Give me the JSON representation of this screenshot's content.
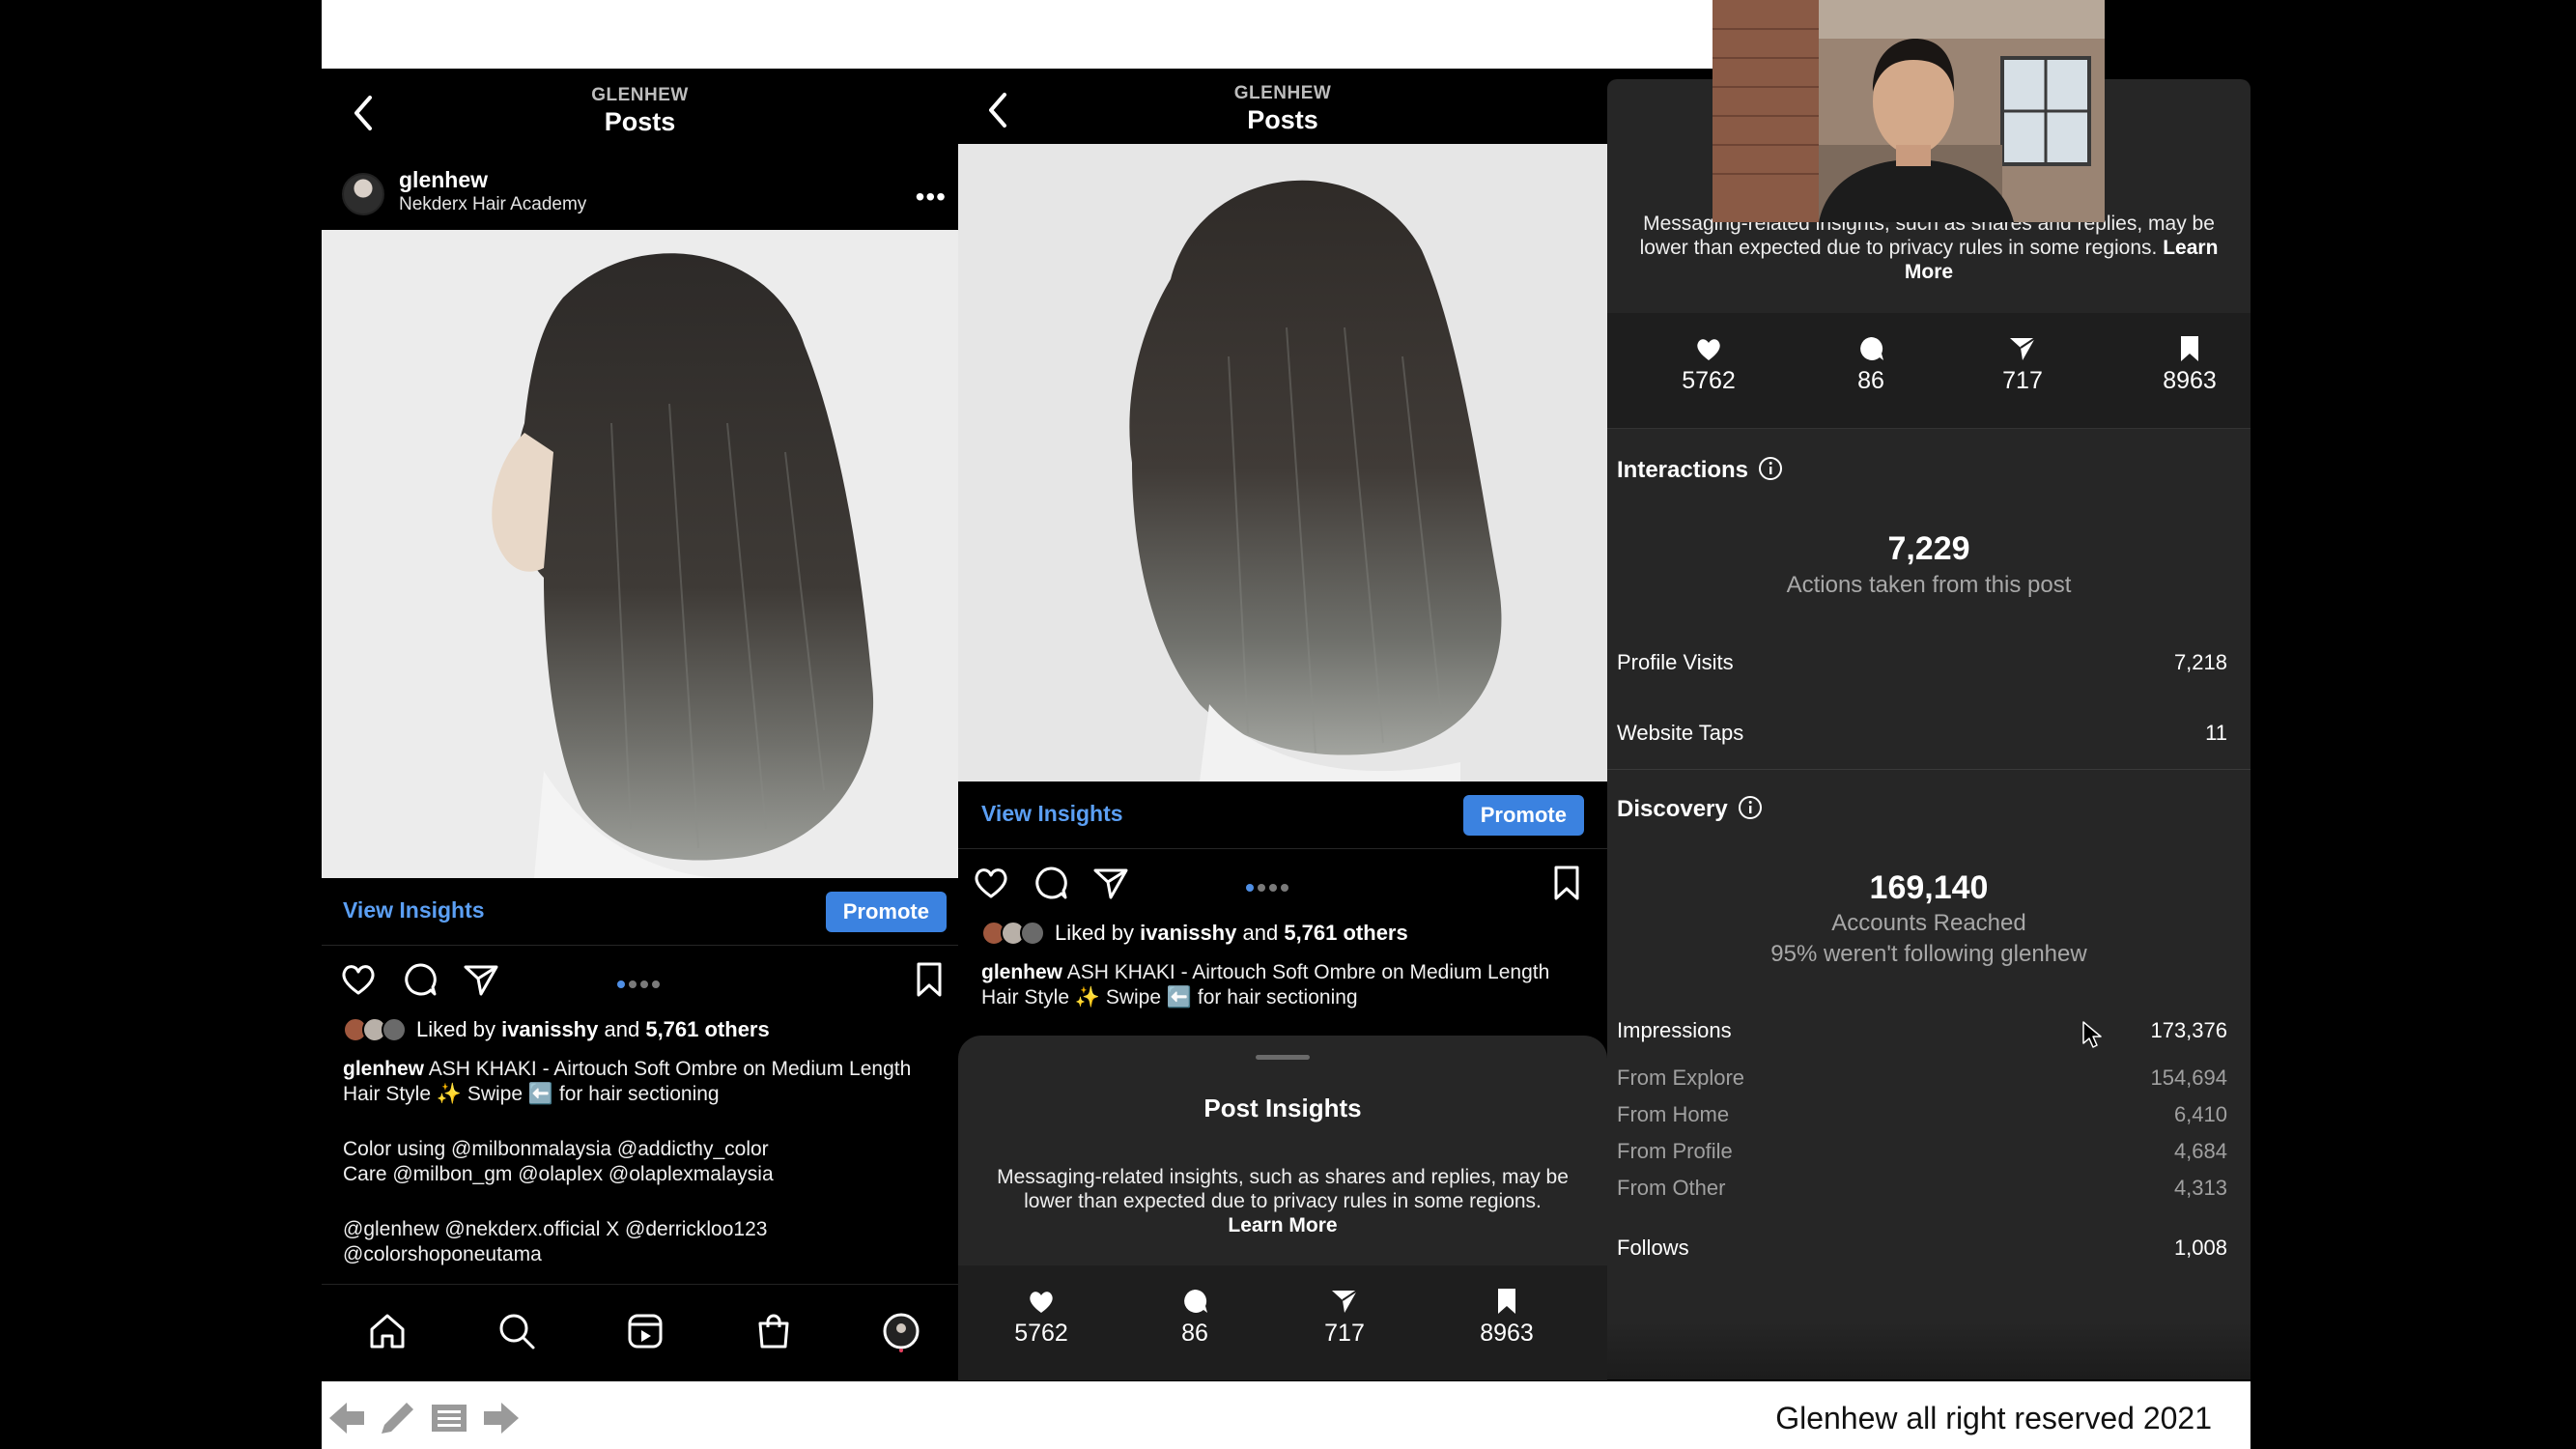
{
  "phone1": {
    "header_user": "GLENHEW",
    "header_title": "Posts",
    "username": "glenhew",
    "subtitle": "Nekderx Hair Academy",
    "view_insights": "View Insights",
    "promote": "Promote",
    "liked_prefix": "Liked by",
    "liked_user": "ivanisshy",
    "liked_and": "and",
    "liked_others": "5,761 others",
    "caption_user": "glenhew",
    "caption_text": "ASH KHAKI - Airtouch Soft Ombre on Medium Length Hair Style ✨ Swipe ⬅️ for hair sectioning",
    "caption_2": "Color using @milbonmalaysia @addicthy_color\nCare @milbon_gm @olaplex @olaplexmalaysia",
    "caption_3": "@glenhew @nekderx.official X @derrickloo123\n@colorshoponeutama",
    "carousel_index": "1 of 4"
  },
  "phone2": {
    "header_user": "GLENHEW",
    "header_title": "Posts",
    "view_insights": "View Insights",
    "promote": "Promote",
    "liked_prefix": "Liked by",
    "liked_user": "ivanisshy",
    "liked_and": "and",
    "liked_others": "5,761 others",
    "caption_user": "glenhew",
    "caption_text": "ASH KHAKI - Airtouch Soft Ombre on Medium Length Hair Style ✨ Swipe ⬅️ for hair sectioning",
    "sheet_title": "Post Insights",
    "sheet_msg": "Messaging-related insights, such as shares and replies, may be lower than expected due to privacy rules in some regions.",
    "learn_more": "Learn More",
    "stats": {
      "likes": "5762",
      "comments": "86",
      "shares": "717",
      "saves": "8963"
    }
  },
  "insights": {
    "title": "Post Insights",
    "msg": "Messaging-related insights, such as shares and replies, may be lower than expected due to privacy rules in some regions.",
    "learn_more": "Learn More",
    "stats": {
      "likes": "5762",
      "comments": "86",
      "shares": "717",
      "saves": "8963"
    },
    "interactions": {
      "label": "Interactions",
      "total": "7,229",
      "total_label": "Actions taken from this post",
      "rows": [
        {
          "label": "Profile Visits",
          "value": "7,218"
        },
        {
          "label": "Website Taps",
          "value": "11"
        }
      ]
    },
    "discovery": {
      "label": "Discovery",
      "reached": "169,140",
      "reached_label": "Accounts Reached",
      "reached_note": "95% weren't following glenhew",
      "impressions_label": "Impressions",
      "impressions": "173,376",
      "sources": [
        {
          "label": "From Explore",
          "value": "154,694"
        },
        {
          "label": "From Home",
          "value": "6,410"
        },
        {
          "label": "From Profile",
          "value": "4,684"
        },
        {
          "label": "From Other",
          "value": "4,313"
        }
      ],
      "follows_label": "Follows",
      "follows": "1,008"
    }
  },
  "footer": {
    "copyright": "Glenhew all right reserved 2021"
  },
  "colors": {
    "link": "#5b9ff4",
    "promote": "#3b82e0",
    "sheet": "#262626",
    "stats_bg": "#1e1e1e"
  },
  "icons": [
    "back-icon",
    "more-icon",
    "heart-icon",
    "comment-icon",
    "share-icon",
    "bookmark-icon",
    "home-icon",
    "search-icon",
    "reels-icon",
    "shop-icon",
    "profile-icon",
    "info-icon",
    "arrow-left-icon",
    "pen-icon",
    "menu-icon",
    "arrow-right-icon"
  ]
}
